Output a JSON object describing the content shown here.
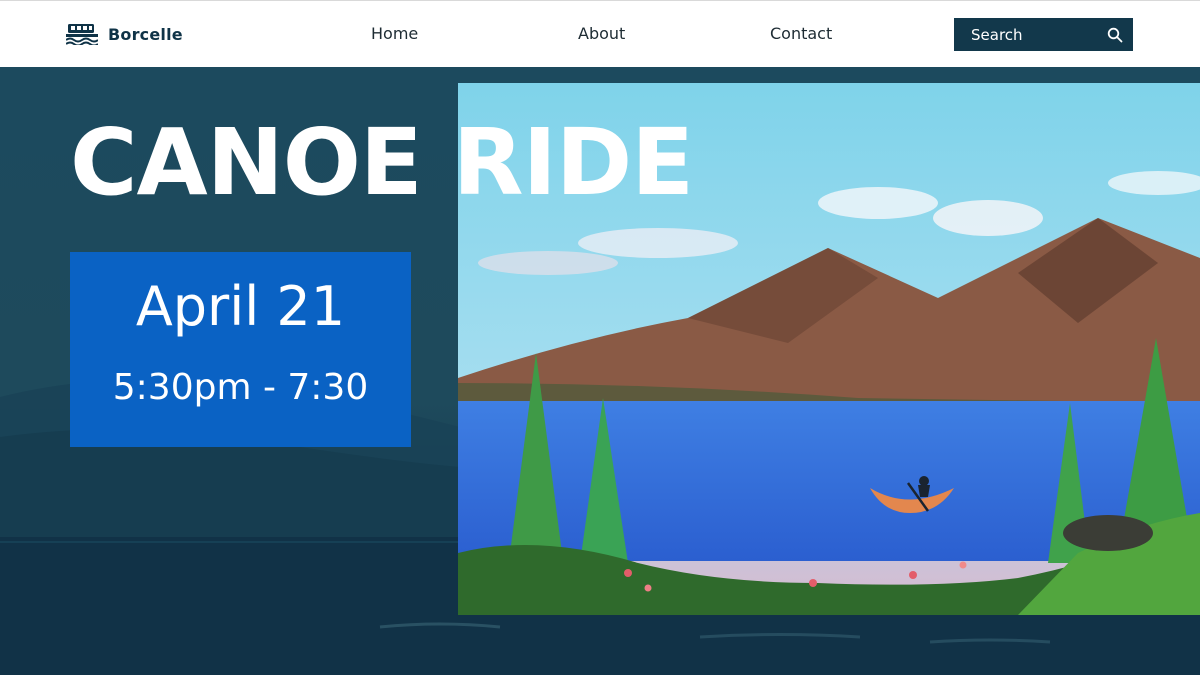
{
  "header": {
    "brand": "Borcelle",
    "logo_icon": "boat-icon",
    "nav": [
      {
        "label": "Home"
      },
      {
        "label": "About"
      },
      {
        "label": "Contact"
      }
    ],
    "search": {
      "placeholder": "Search",
      "icon": "search-icon"
    }
  },
  "hero": {
    "title": "CANOE RIDE",
    "date": "April 21",
    "time": "5:30pm - 7:30",
    "image": "painting of a person paddling a canoe on a blue lake with mountains and pine trees"
  },
  "colors": {
    "header_bg": "#ffffff",
    "brand": "#0f3347",
    "search_bg": "#12384b",
    "hero_bg": "#1b4a5f",
    "date_box": "#0a62c4",
    "title": "#ffffff"
  }
}
